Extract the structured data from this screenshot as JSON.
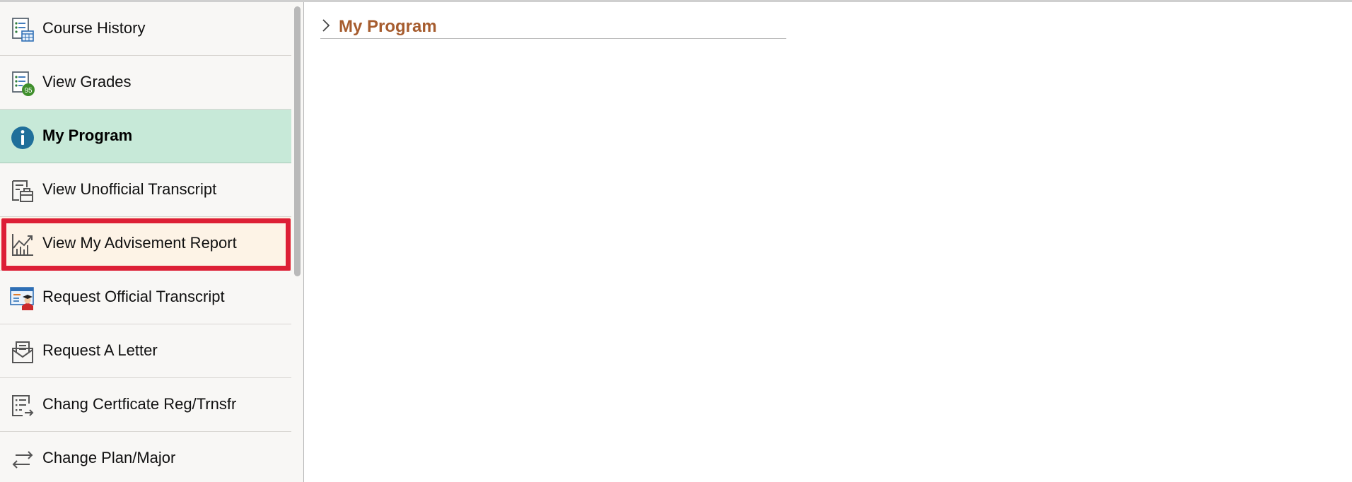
{
  "sidebar": {
    "items": [
      {
        "label": "Course History",
        "icon": "course-history-icon"
      },
      {
        "label": "View Grades",
        "icon": "grades-icon",
        "badge": "95"
      },
      {
        "label": "My Program",
        "icon": "info-icon",
        "active": true
      },
      {
        "label": "View Unofficial Transcript",
        "icon": "transcript-icon"
      },
      {
        "label": "View My Advisement Report",
        "icon": "chart-icon",
        "highlighted": true
      },
      {
        "label": "Request Official Transcript",
        "icon": "graduate-icon"
      },
      {
        "label": "Request A Letter",
        "icon": "letter-icon"
      },
      {
        "label": "Chang Certficate Reg/Trnsfr",
        "icon": "list-transfer-icon"
      },
      {
        "label": "Change Plan/Major",
        "icon": "swap-arrows-icon"
      }
    ]
  },
  "main": {
    "section_title": "My Program"
  },
  "colors": {
    "active_bg": "#c7e9d8",
    "highlight_border": "#dd1f35",
    "title_color": "#a65c2e"
  }
}
